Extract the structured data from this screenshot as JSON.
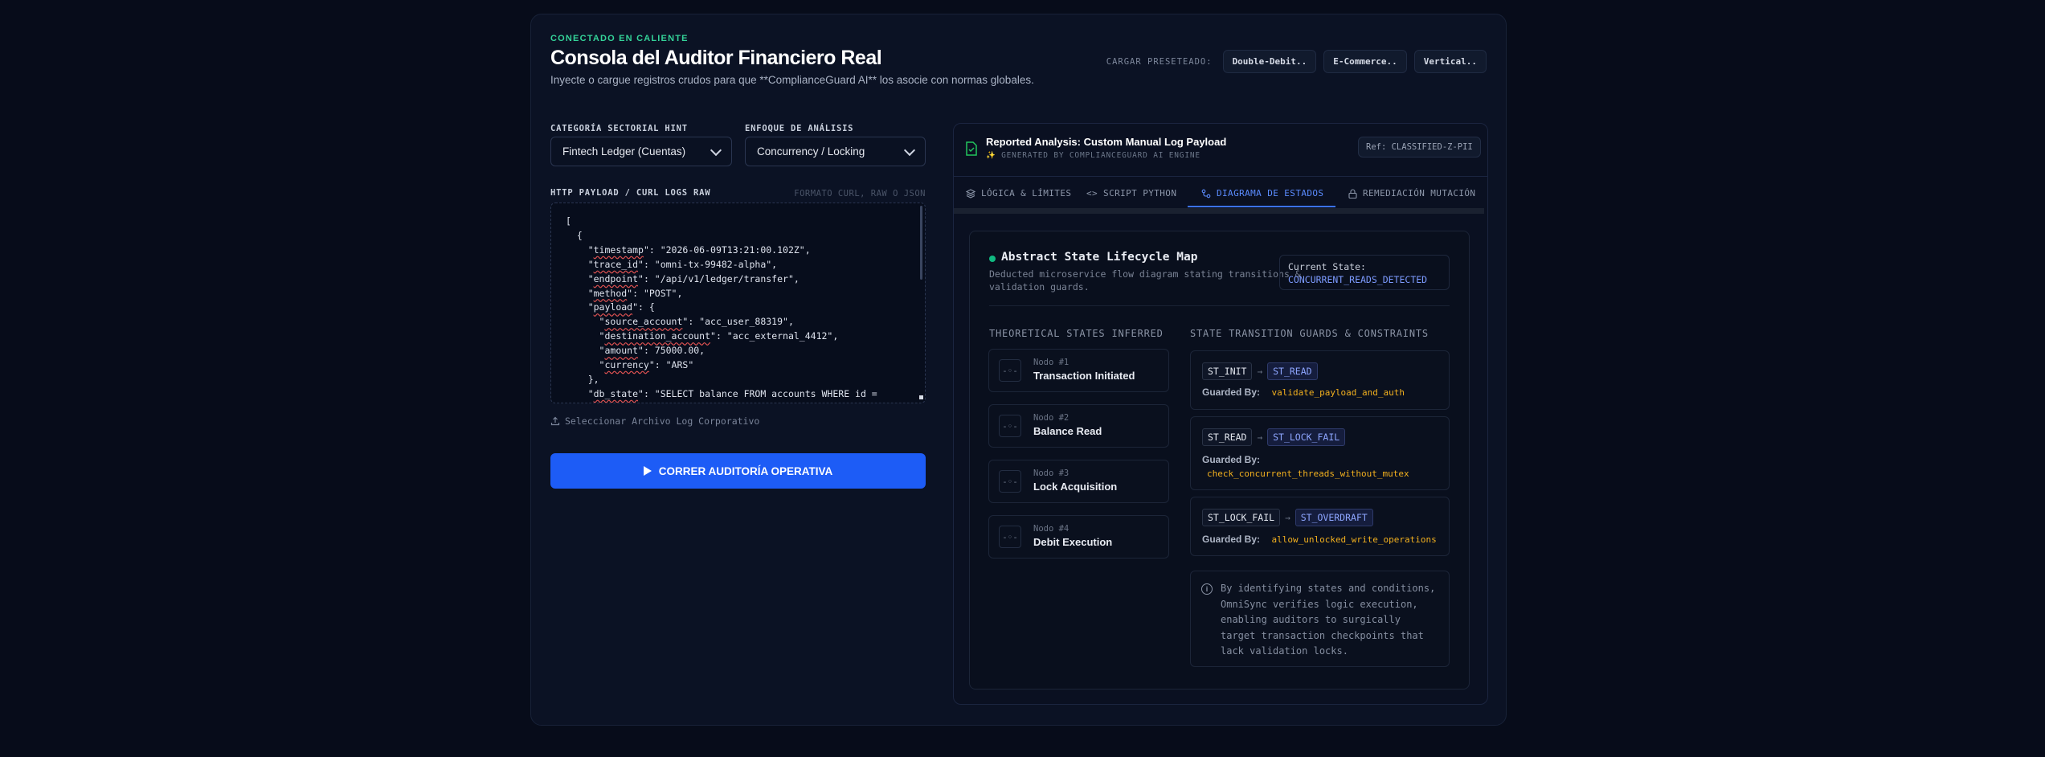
{
  "header": {
    "eyebrow": "CONECTADO EN CALIENTE",
    "title": "Consola del Auditor Financiero Real",
    "subtitle": "Inyecte o cargue registros crudos para que **ComplianceGuard AI** los asocie con normas globales."
  },
  "presets": {
    "label": "CARGAR PRESETEADO:",
    "items": [
      "Double-Debit..",
      "E-Commerce..",
      "Vertical.."
    ]
  },
  "form": {
    "category_label": "CATEGORÍA SECTORIAL HINT",
    "category_value": "Fintech Ledger (Cuentas)",
    "focus_label": "ENFOQUE DE ANÁLISIS",
    "focus_value": "Concurrency / Locking",
    "payload_label": "HTTP PAYLOAD / CURL LOGS RAW",
    "payload_hint": "FORMATO CURL, RAW O JSON",
    "payload_lines": [
      "[",
      "  {",
      "    \"timestamp\": \"2026-06-09T13:21:00.102Z\",",
      "    \"trace_id\": \"omni-tx-99482-alpha\",",
      "    \"endpoint\": \"/api/v1/ledger/transfer\",",
      "    \"method\": \"POST\",",
      "    \"payload\": {",
      "      \"source_account\": \"acc_user_88319\",",
      "      \"destination_account\": \"acc_external_4412\",",
      "      \"amount\": 75000.00,",
      "      \"currency\": \"ARS\"",
      "    },",
      "    \"db_state\": \"SELECT balance FROM accounts WHERE id ="
    ],
    "upload_label": "Seleccionar Archivo Log Corporativo",
    "run_label": "CORRER AUDITORÍA OPERATIVA"
  },
  "report": {
    "title": "Reported Analysis: Custom Manual Log Payload",
    "subtitle": "✨ GENERATED BY COMPLIANCEGUARD AI ENGINE",
    "ref": "Ref: CLASSIFIED-Z-PII",
    "tabs": [
      "LÓGICA & LÍMITES",
      "SCRIPT PYTHON",
      "DIAGRAMA DE ESTADOS",
      "REMEDIACIÓN MUTACIÓN"
    ],
    "active_tab": "DIAGRAMA DE ESTADOS"
  },
  "diagram": {
    "title": "Abstract State Lifecycle Map",
    "description": "Deducted microservice flow diagram stating transitions & validation guards.",
    "current_state_label": "Current State:",
    "current_state_value": "CONCURRENT_READS_DETECTED",
    "states_heading": "THEORETICAL STATES INFERRED",
    "guards_heading": "STATE TRANSITION GUARDS & CONSTRAINTS",
    "nodes": [
      {
        "num": "Nodo #1",
        "name": "Transaction Initiated"
      },
      {
        "num": "Nodo #2",
        "name": "Balance Read"
      },
      {
        "num": "Nodo #3",
        "name": "Lock Acquisition"
      },
      {
        "num": "Nodo #4",
        "name": "Debit Execution"
      }
    ],
    "guards": [
      {
        "from": "ST_INIT",
        "to": "ST_READ",
        "label": "Guarded By:",
        "fn": "validate_payload_and_auth"
      },
      {
        "from": "ST_READ",
        "to": "ST_LOCK_FAIL",
        "label": "Guarded By:",
        "fn": "check_concurrent_threads_without_mutex"
      },
      {
        "from": "ST_LOCK_FAIL",
        "to": "ST_OVERDRAFT",
        "label": "Guarded By:",
        "fn": "allow_unlocked_write_operations"
      }
    ],
    "arrow": "→",
    "info": "By identifying states and conditions, OmniSync verifies logic execution, enabling auditors to surgically target transaction checkpoints that lack validation locks."
  },
  "colors": {
    "accent": "#1d5cf6",
    "live": "#34d399",
    "guard_fn": "#f2b01e",
    "state_target": "#8ea6ff"
  }
}
